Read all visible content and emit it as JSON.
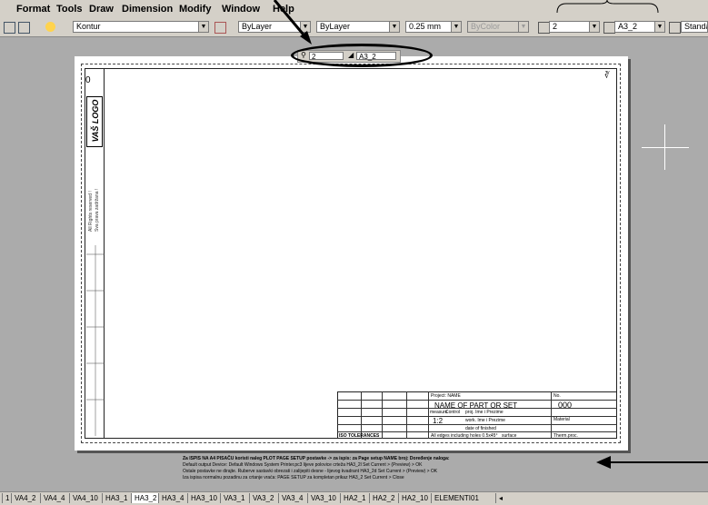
{
  "menu": [
    "Format",
    "Tools",
    "Draw",
    "Dimension",
    "Modify",
    "Window",
    "Help"
  ],
  "toolbar": {
    "layer_combo": "Kontur",
    "color_combo": "ByLayer",
    "linetype_combo": "ByLayer",
    "lineweight_combo": "0.25 mm",
    "plotstyle_combo": "ByColor",
    "dimstyle_combo": "2",
    "textstyle_combo": "A3_2",
    "standard_combo": "Standard"
  },
  "floating_toolbar": {
    "dim": "2",
    "text": "A3_2"
  },
  "drawing": {
    "logo": "VAŠ LOGO",
    "rights_1": "All Rights reserved !",
    "rights_2": "Sva prava zadržana !",
    "zero_marker": "0",
    "title": {
      "project_label": "Project: NAME",
      "name": "NAME OF PART OR SET",
      "no_label": "No.",
      "number": "000",
      "measure_label": "measure",
      "control_label": "Control",
      "scale": "1:2",
      "proj_label": "proj.  Ime i Prezime",
      "work_label": "work.  Ime i Prezime",
      "date_label": "date of finished",
      "material_label": "Material",
      "iso_tol": "ISO TOLERANCES",
      "edges": "All edges including holes 0.5x45°",
      "surface": "surface",
      "therm": "Therm.proc."
    },
    "notes": [
      "Za ISPIS NA A4 PISAČU koristi naleg PLOT PAGE SETUP postavke ->   za ispis:        za Page setup NAME broj:   Doređenje naloga:",
      "Default output Device: Default Windows System Printer.pc3        lijeve polovice crteža          HA3_2l          Set Current > (Preview) > OK",
      "Ostale postavke ne dirajte. Ruberve sastavki obrezati i zalijepiti     desne - lijevog kvadrant      HA3_2d          Set Current > (Preview) > OK",
      "Iza ispisa normalnu pozadinu za crtanje vraća:  PAGE SETUP          za kompletan prikaz          HA3_2           Set Current > Close"
    ]
  },
  "tabs": [
    "1",
    "VA4_2",
    "VA4_4",
    "VA4_10",
    "HA3_1",
    "HA3_2",
    "HA3_4",
    "HA3_10",
    "VA3_1",
    "VA3_2",
    "VA3_4",
    "VA3_10",
    "HA2_1",
    "HA2_2",
    "HA2_10",
    "ELEMENTI01"
  ],
  "active_tab": "HA3_2"
}
